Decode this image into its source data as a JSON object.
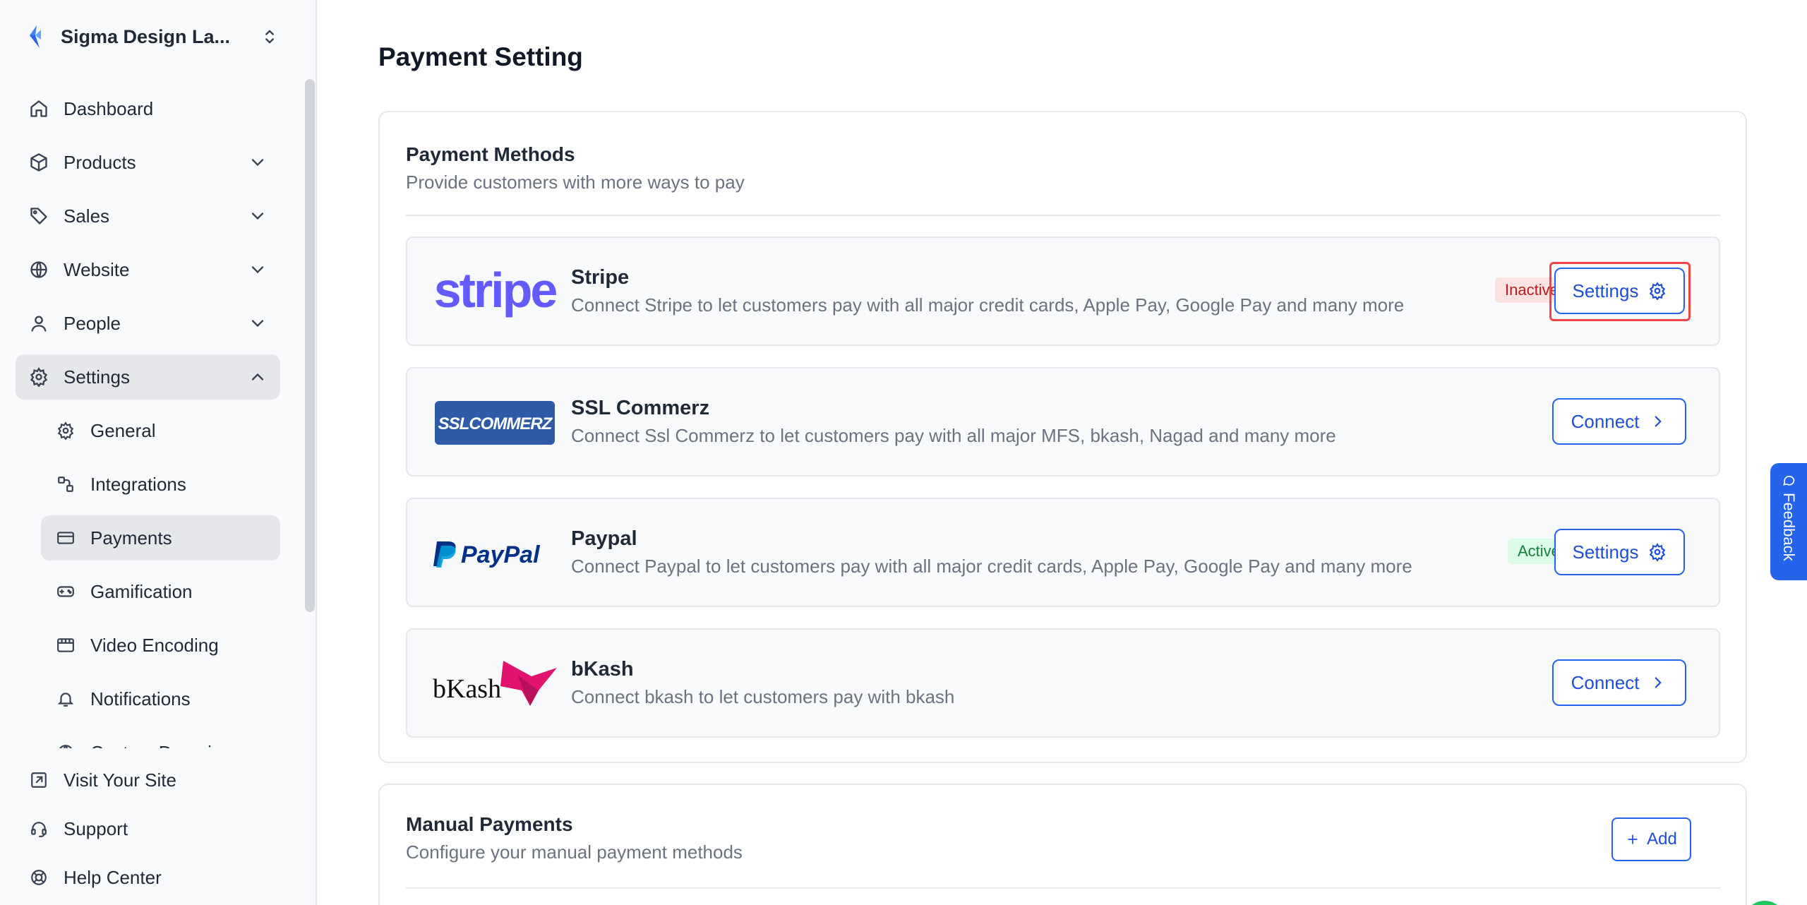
{
  "sidebar": {
    "org_name": "Sigma Design La...",
    "nav": {
      "dashboard": "Dashboard",
      "products": "Products",
      "sales": "Sales",
      "website": "Website",
      "people": "People",
      "settings": "Settings"
    },
    "settings_sub": {
      "general": "General",
      "integrations": "Integrations",
      "payments": "Payments",
      "gamification": "Gamification",
      "video_encoding": "Video Encoding",
      "notifications": "Notifications",
      "custom_domain": "Custom Domain"
    },
    "bottom": {
      "visit_site": "Visit Your Site",
      "support": "Support",
      "help_center": "Help Center"
    }
  },
  "main": {
    "page_title": "Payment Setting",
    "payment_methods": {
      "title": "Payment Methods",
      "subtitle": "Provide customers with more ways to pay",
      "items": [
        {
          "logo_text": "stripe",
          "name": "Stripe",
          "description": "Connect Stripe to let customers pay with all major credit cards, Apple Pay, Google Pay and many more",
          "status": "Inactive",
          "action": "Settings"
        },
        {
          "logo_text": "SSLCOMMERZ",
          "name": "SSL Commerz",
          "description": "Connect Ssl Commerz to let customers pay with all major MFS, bkash, Nagad and many more",
          "status": "",
          "action": "Connect"
        },
        {
          "logo_text": "PayPal",
          "name": "Paypal",
          "description": "Connect Paypal to let customers pay with all major credit cards, Apple Pay, Google Pay and many more",
          "status": "Active",
          "action": "Settings"
        },
        {
          "logo_text": "bKash",
          "name": "bKash",
          "description": "Connect bkash to let customers pay with bkash",
          "status": "",
          "action": "Connect"
        }
      ]
    },
    "manual_payments": {
      "title": "Manual Payments",
      "subtitle": "Configure your manual payment methods",
      "add_label": "Add"
    }
  },
  "feedback_label": "Feedback",
  "colors": {
    "primary": "#2563eb",
    "inactive_bg": "#fde2e2",
    "inactive_text": "#b91c1c",
    "active_bg": "#dcfce7",
    "active_text": "#15803d",
    "highlight": "#ef4444",
    "stripe": "#635bff",
    "paypal_dark": "#003087",
    "paypal_light": "#009cde",
    "bkash": "#e2136e"
  }
}
